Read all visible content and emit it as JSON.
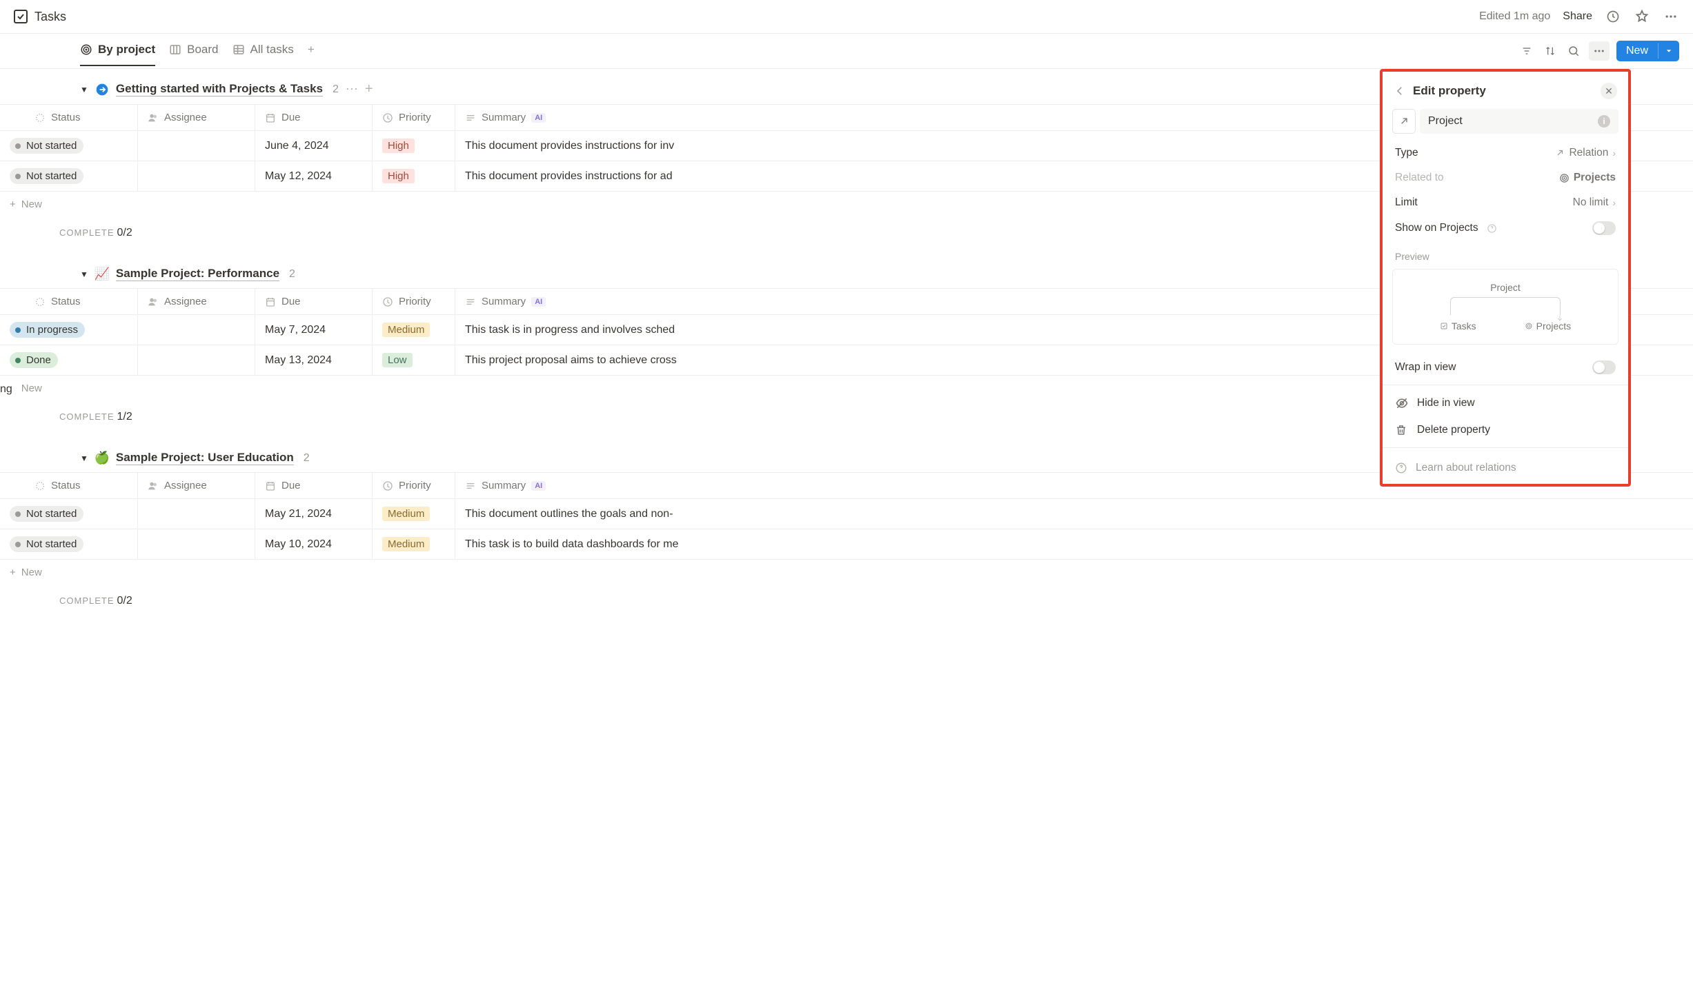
{
  "header": {
    "title": "Tasks",
    "edited": "Edited 1m ago",
    "share": "Share"
  },
  "views": {
    "tabs": [
      {
        "label": "By project",
        "active": true
      },
      {
        "label": "Board",
        "active": false
      },
      {
        "label": "All tasks",
        "active": false
      }
    ],
    "new_button": "New"
  },
  "columns": {
    "status": "Status",
    "assignee": "Assignee",
    "due": "Due",
    "priority": "Priority",
    "summary": "Summary",
    "ai_tag": "AI"
  },
  "groups": [
    {
      "icon": "arrow-circle",
      "name": "Getting started with Projects & Tasks",
      "count": "2",
      "rows": [
        {
          "status": "Not started",
          "status_class": "b-not",
          "due": "June 4, 2024",
          "priority": "High",
          "pri_class": "p-high",
          "summary": "This document provides instructions for inv"
        },
        {
          "status": "Not started",
          "status_class": "b-not",
          "due": "May 12, 2024",
          "priority": "High",
          "pri_class": "p-high",
          "summary": "This document provides instructions for ad"
        }
      ],
      "complete": "0/2"
    },
    {
      "icon": "chart-emoji",
      "name": "Sample Project: Performance",
      "count": "2",
      "rows": [
        {
          "status": "In progress",
          "status_class": "b-prog",
          "due": "May 7, 2024",
          "priority": "Medium",
          "pri_class": "p-med",
          "summary": "This task is in progress and involves sched",
          "name_cut": "ng"
        },
        {
          "status": "Done",
          "status_class": "b-done",
          "due": "May 13, 2024",
          "priority": "Low",
          "pri_class": "p-low",
          "summary": "This project proposal aims to achieve cross"
        }
      ],
      "complete": "1/2"
    },
    {
      "icon": "apple-emoji",
      "name": "Sample Project: User Education",
      "count": "2",
      "rows": [
        {
          "status": "Not started",
          "status_class": "b-not",
          "due": "May 21, 2024",
          "priority": "Medium",
          "pri_class": "p-med",
          "summary": "This document outlines the goals and non-"
        },
        {
          "status": "Not started",
          "status_class": "b-not",
          "due": "May 10, 2024",
          "priority": "Medium",
          "pri_class": "p-med",
          "summary": "This task is to build data dashboards for me"
        }
      ],
      "complete": "0/2"
    }
  ],
  "add_new": "New",
  "complete_label": "COMPLETE",
  "popup": {
    "title": "Edit property",
    "name_value": "Project",
    "type_label": "Type",
    "type_value": "Relation",
    "related_label": "Related to",
    "related_value": "Projects",
    "limit_label": "Limit",
    "limit_value": "No limit",
    "show_on_label": "Show on Projects",
    "preview_label": "Preview",
    "preview_top": "Project",
    "preview_left": "Tasks",
    "preview_right": "Projects",
    "wrap_label": "Wrap in view",
    "hide_label": "Hide in view",
    "delete_label": "Delete property",
    "learn_label": "Learn about relations"
  }
}
